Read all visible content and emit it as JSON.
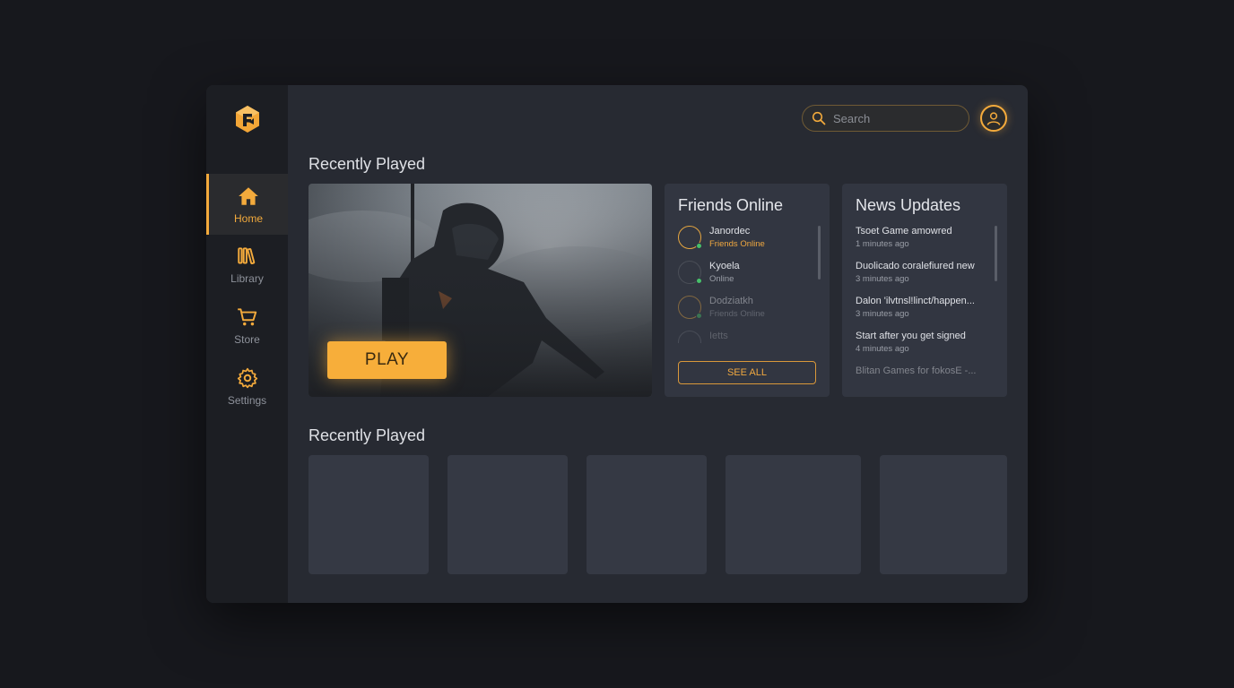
{
  "colors": {
    "accent": "#f3aa3c",
    "online": "#47c06a",
    "background": "#17181d",
    "panel": "#323641"
  },
  "sidebar": {
    "logo_icon": "brand-logo-icon",
    "items": [
      {
        "label": "Home",
        "icon": "home-icon",
        "active": true
      },
      {
        "label": "Library",
        "icon": "library-icon",
        "active": false
      },
      {
        "label": "Store",
        "icon": "cart-icon",
        "active": false
      },
      {
        "label": "Settings",
        "icon": "gear-icon",
        "active": false
      }
    ]
  },
  "header": {
    "search_placeholder": "Search",
    "search_icon": "search-icon",
    "avatar_icon": "user-avatar-icon"
  },
  "recently_played_title": "Recently Played",
  "hero": {
    "play_label": "PLAY"
  },
  "friends": {
    "title": "Friends Online",
    "items": [
      {
        "name": "Janordec",
        "status": "Friends Online"
      },
      {
        "name": "Kyoela",
        "status": "Online"
      },
      {
        "name": "Dodziatkh",
        "status": "Friends Online"
      },
      {
        "name": "Ietts",
        "status": ""
      }
    ],
    "see_all_label": "SEE ALL"
  },
  "news": {
    "title": "News Updates",
    "items": [
      {
        "headline": "Tsoet Game amowred",
        "time": "1 minutes ago"
      },
      {
        "headline": "Duolicado coralefiured new",
        "time": "3 minutes ago"
      },
      {
        "headline": "Dalon 'ilvtnsl!linct/happen...",
        "time": "3 minutes ago"
      },
      {
        "headline": "Start after you get signed",
        "time": "4 minutes ago"
      },
      {
        "headline": "Blitan Games for fokosE -...",
        "time": ""
      }
    ]
  },
  "recently_played_2_title": "Recently Played",
  "tiles_count": 5
}
